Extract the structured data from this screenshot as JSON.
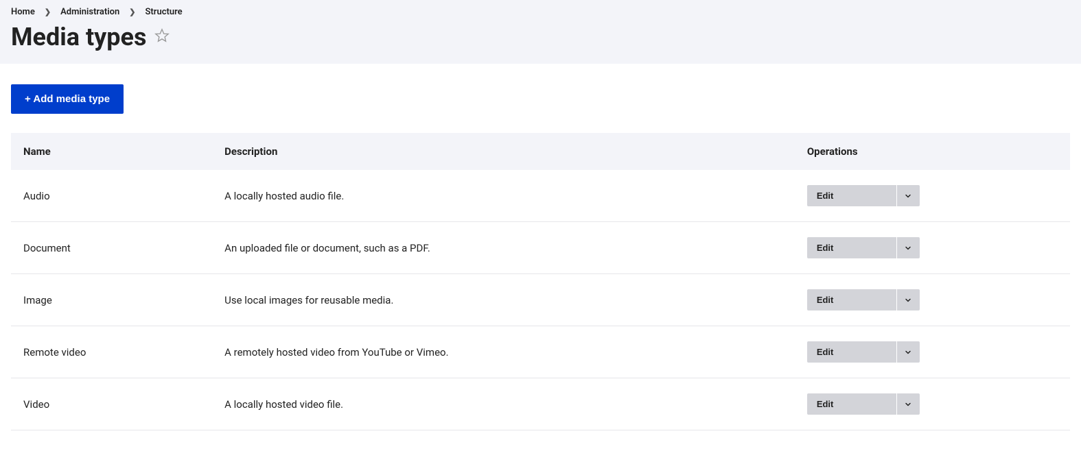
{
  "breadcrumb": {
    "items": [
      "Home",
      "Administration",
      "Structure"
    ]
  },
  "page_title": "Media types",
  "add_button": "+ Add media type",
  "table": {
    "headers": {
      "name": "Name",
      "description": "Description",
      "operations": "Operations"
    },
    "rows": [
      {
        "name": "Audio",
        "description": "A locally hosted audio file.",
        "op": "Edit"
      },
      {
        "name": "Document",
        "description": "An uploaded file or document, such as a PDF.",
        "op": "Edit"
      },
      {
        "name": "Image",
        "description": "Use local images for reusable media.",
        "op": "Edit"
      },
      {
        "name": "Remote video",
        "description": "A remotely hosted video from YouTube or Vimeo.",
        "op": "Edit"
      },
      {
        "name": "Video",
        "description": "A locally hosted video file.",
        "op": "Edit"
      }
    ]
  }
}
